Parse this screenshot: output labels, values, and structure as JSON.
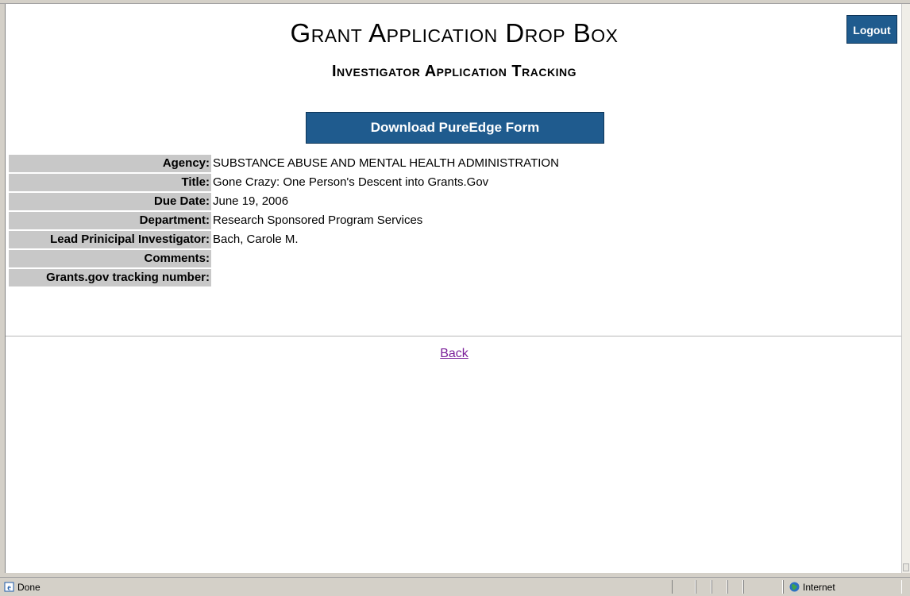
{
  "header": {
    "title": "Grant Application Drop Box",
    "subtitle": "Investigator Application Tracking",
    "logout_label": "Logout"
  },
  "actions": {
    "download_label": "Download PureEdge Form"
  },
  "details": [
    {
      "label": "Agency:",
      "value": "SUBSTANCE ABUSE AND MENTAL HEALTH ADMINISTRATION"
    },
    {
      "label": "Title:",
      "value": "Gone Crazy: One Person's Descent into Grants.Gov"
    },
    {
      "label": "Due Date:",
      "value": "June 19, 2006"
    },
    {
      "label": "Department:",
      "value": "Research Sponsored Program Services"
    },
    {
      "label": "Lead Prinicipal Investigator:",
      "value": "Bach, Carole M."
    },
    {
      "label": "Comments:",
      "value": ""
    },
    {
      "label": "Grants.gov tracking number:",
      "value": ""
    }
  ],
  "nav": {
    "back_label": "Back"
  },
  "statusbar": {
    "status_text": "Done",
    "status_icon": "ie-page-icon",
    "zone_text": "Internet",
    "zone_icon": "globe-icon"
  },
  "colors": {
    "button_blue": "#1f5b8e",
    "label_gray": "#c8c8c8",
    "link_visited": "#7b1f9a"
  }
}
